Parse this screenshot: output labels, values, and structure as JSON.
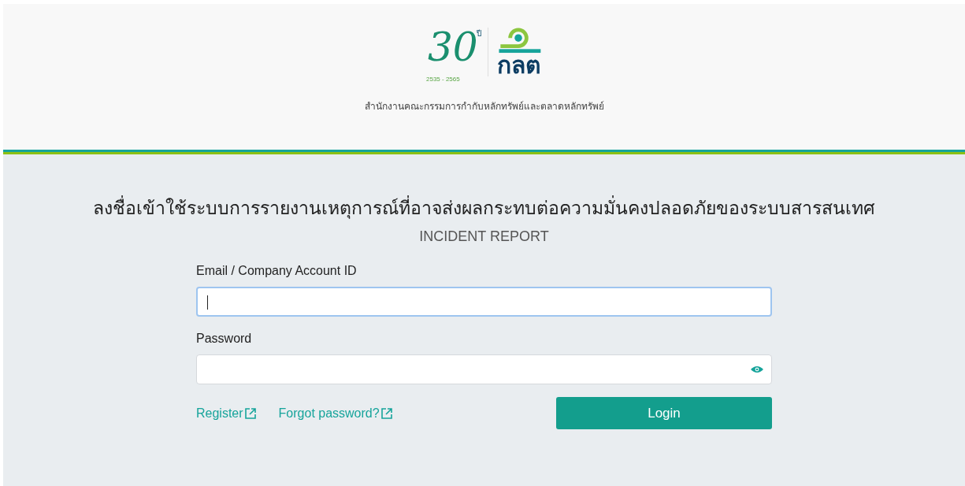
{
  "header": {
    "logo": {
      "anniversary": "30",
      "year_mark": "ปี",
      "years": "2535 - 2565",
      "acronym": "กลต"
    },
    "organization": "สำนักงานคณะกรรมการกำกับหลักทรัพย์และตลาดหลักทรัพย์"
  },
  "login": {
    "title": "ลงชื่อเข้าใช้ระบบการรายงานเหตุการณ์ที่อาจส่งผลกระทบต่อความมั่นคงปลอดภัยของระบบสารสนเทศ",
    "subtitle": "INCIDENT REPORT",
    "fields": [
      {
        "label": "Email / Company Account ID",
        "kind": "text",
        "focused": true
      },
      {
        "label": "Password",
        "kind": "password",
        "focused": false
      }
    ],
    "links": [
      "Register",
      "Forgot password?"
    ],
    "button": "Login"
  }
}
